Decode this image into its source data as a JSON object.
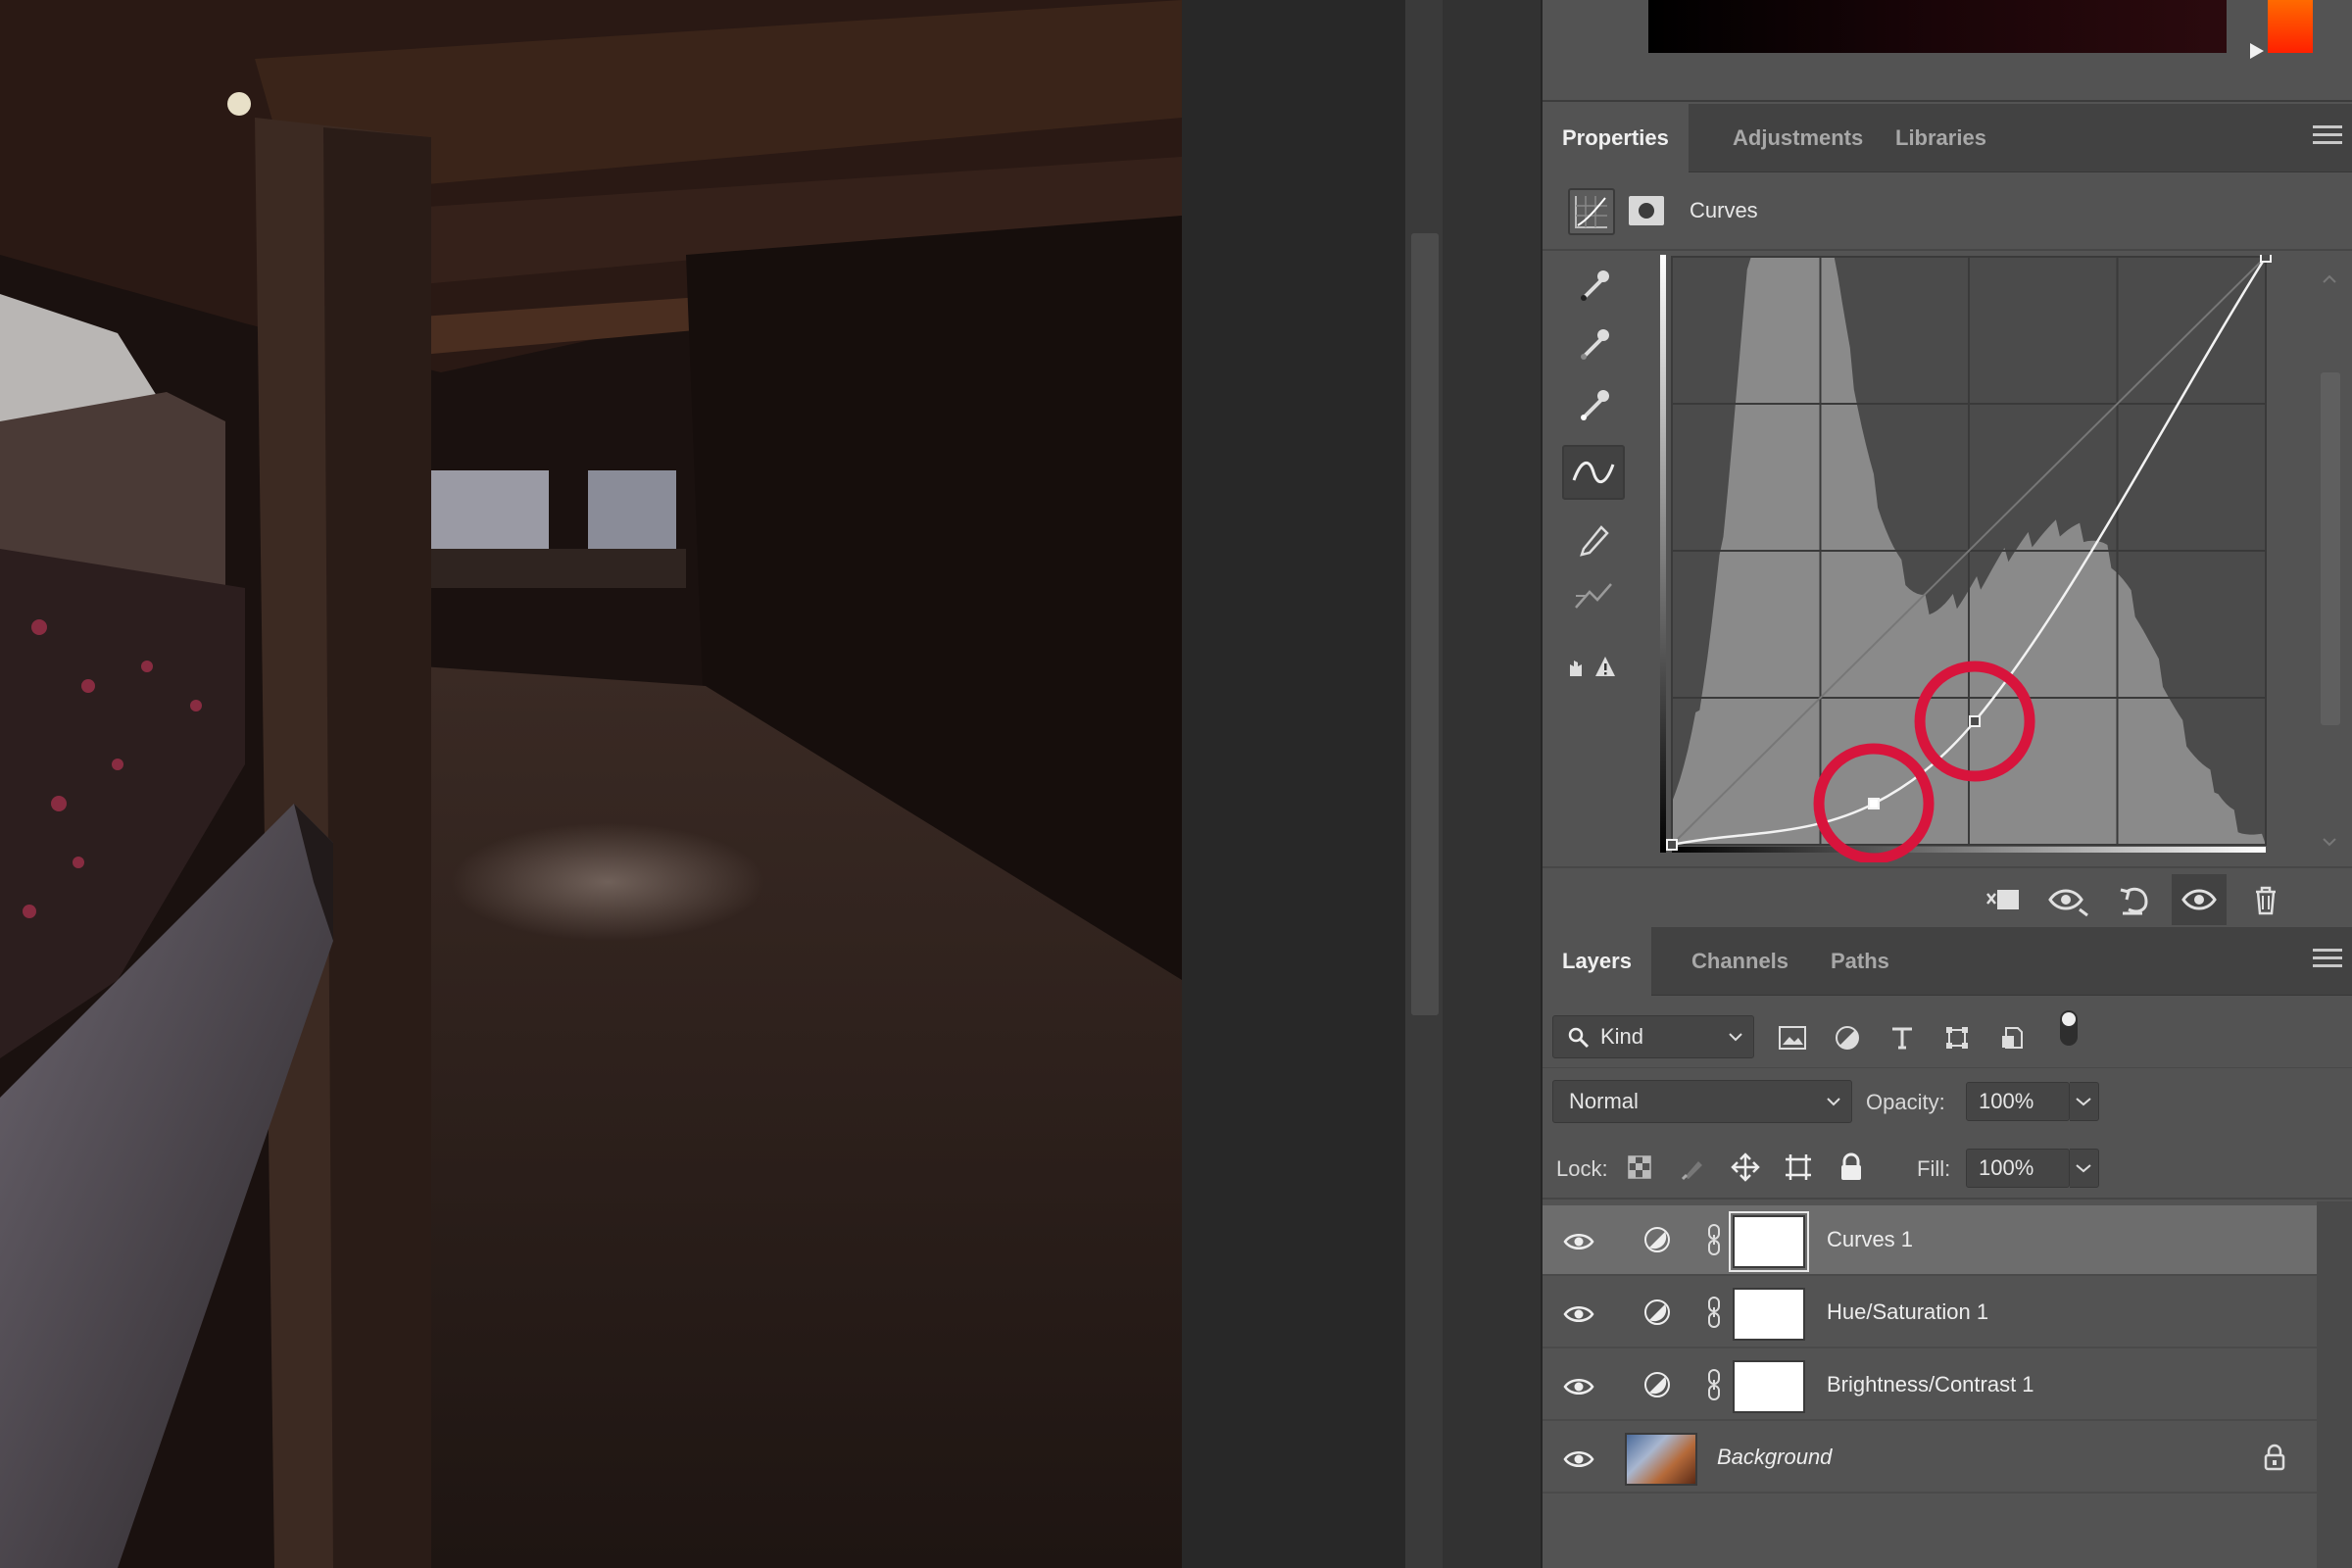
{
  "colors": {
    "accent_red": "#d8143c",
    "panel": "#535353",
    "tab_bar": "#424242"
  },
  "properties": {
    "tabs": [
      {
        "label": "Properties",
        "active": true
      },
      {
        "label": "Adjustments",
        "active": false
      },
      {
        "label": "Libraries",
        "active": false
      }
    ],
    "title": "Curves",
    "tools": [
      "eyedropper-black-icon",
      "eyedropper-gray-icon",
      "eyedropper-white-icon",
      "curve-point-icon",
      "pencil-icon",
      "smooth-curve-icon",
      "histogram-warning-icon"
    ],
    "footer_buttons": [
      "clip-to-layer-icon",
      "view-previous-icon",
      "reset-icon",
      "visibility-icon",
      "trash-icon"
    ]
  },
  "curves": {
    "points": [
      [
        0,
        0
      ],
      [
        34,
        7
      ],
      [
        51,
        21
      ],
      [
        100,
        100
      ]
    ],
    "highlighted_points": [
      [
        34,
        7
      ],
      [
        51,
        21
      ]
    ]
  },
  "layers_panel": {
    "tabs": [
      {
        "label": "Layers",
        "active": true
      },
      {
        "label": "Channels",
        "active": false
      },
      {
        "label": "Paths",
        "active": false
      }
    ],
    "filter_label": "Kind",
    "blend_mode": "Normal",
    "opacity_label": "Opacity:",
    "opacity_value": "100%",
    "lock_label": "Lock:",
    "fill_label": "Fill:",
    "fill_value": "100%",
    "layers": [
      {
        "name": "Curves 1",
        "type": "adjustment",
        "selected": true
      },
      {
        "name": "Hue/Saturation 1",
        "type": "adjustment",
        "selected": false
      },
      {
        "name": "Brightness/Contrast 1",
        "type": "adjustment",
        "selected": false
      },
      {
        "name": "Background",
        "type": "image",
        "selected": false,
        "locked": true
      }
    ]
  }
}
